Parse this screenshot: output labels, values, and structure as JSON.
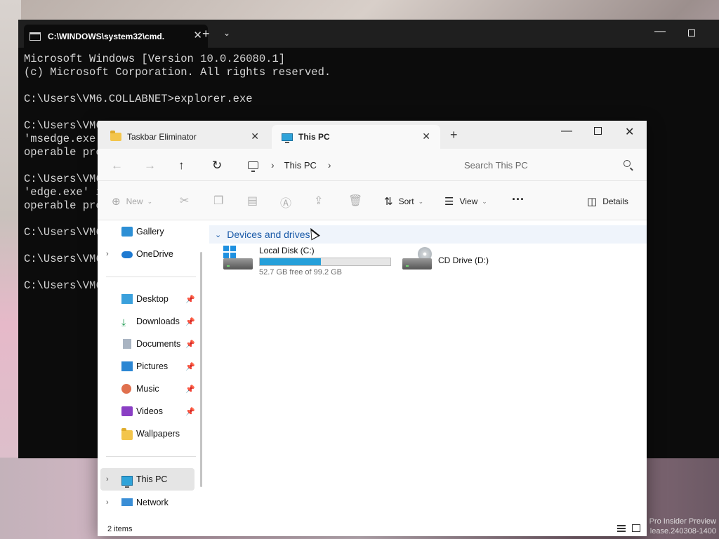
{
  "desktop": {
    "watermark_line1": "Pro Insider Preview",
    "watermark_line2": "lease.240308-1400"
  },
  "cmd": {
    "tab_title": "C:\\WINDOWS\\system32\\cmd.",
    "lines": [
      "Microsoft Windows [Version 10.0.26080.1]",
      "(c) Microsoft Corporation. All rights reserved.",
      "",
      "C:\\Users\\VM6.COLLABNET>explorer.exe",
      "",
      "C:\\Users\\VM6",
      "'msedge.exe'",
      "operable pro",
      "",
      "C:\\Users\\VM6",
      "'edge.exe' i",
      "operable pro",
      "",
      "C:\\Users\\VM6",
      "",
      "C:\\Users\\VM6",
      "",
      "C:\\Users\\VM6"
    ]
  },
  "explorer": {
    "tabs": [
      {
        "label": "Taskbar Eliminator",
        "active": false
      },
      {
        "label": "This PC",
        "active": true
      }
    ],
    "address": {
      "crumb": "This PC"
    },
    "search": {
      "placeholder": "Search This PC"
    },
    "toolbar": {
      "new_label": "New",
      "sort_label": "Sort",
      "view_label": "View",
      "details_label": "Details"
    },
    "nav": {
      "top": [
        {
          "label": "Gallery"
        },
        {
          "label": "OneDrive"
        }
      ],
      "quick": [
        {
          "label": "Desktop",
          "pinned": true
        },
        {
          "label": "Downloads",
          "pinned": true
        },
        {
          "label": "Documents",
          "pinned": true
        },
        {
          "label": "Pictures",
          "pinned": true
        },
        {
          "label": "Music",
          "pinned": true
        },
        {
          "label": "Videos",
          "pinned": true
        },
        {
          "label": "Wallpapers",
          "pinned": false
        }
      ],
      "bottom": [
        {
          "label": "This PC",
          "selected": true
        },
        {
          "label": "Network"
        }
      ]
    },
    "group_header": "Devices and drives",
    "drives": [
      {
        "name": "Local Disk (C:)",
        "free_text": "52.7 GB free of 99.2 GB",
        "used_fraction": 0.469
      },
      {
        "name": "CD Drive (D:)"
      }
    ],
    "status": {
      "items_count": "2 items"
    }
  },
  "colors": {
    "accent": "#26a0da",
    "group_header_text": "#1a5aa8",
    "cmd_bg": "#0c0c0c"
  }
}
